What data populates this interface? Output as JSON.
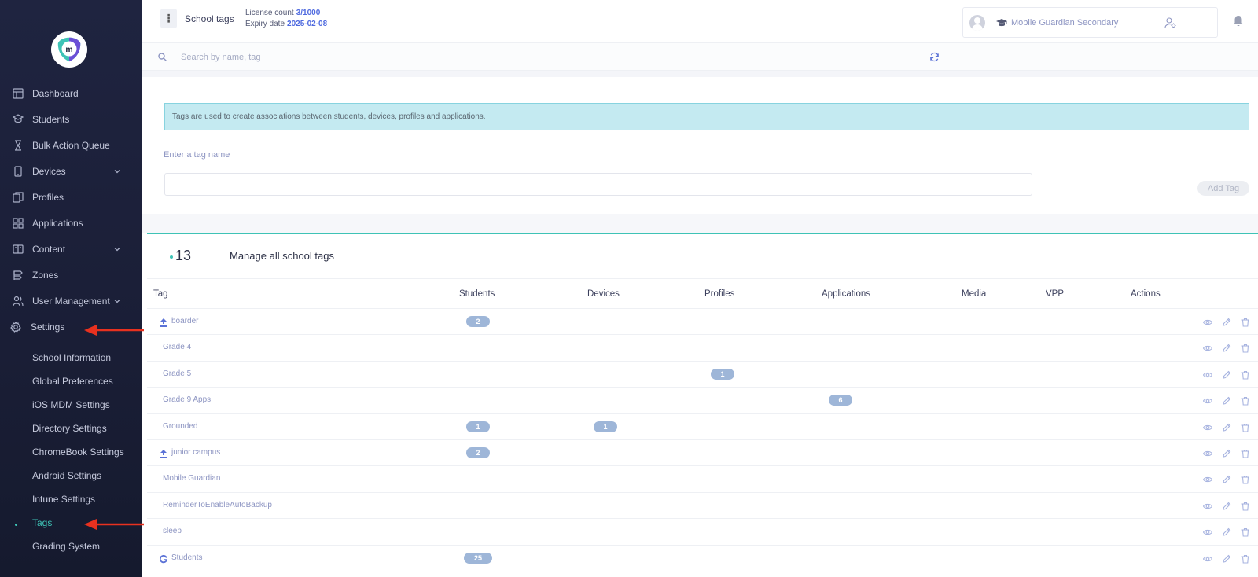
{
  "sidebar": {
    "items": [
      {
        "label": "Dashboard",
        "icon": "dashboard-icon"
      },
      {
        "label": "Students",
        "icon": "students-icon"
      },
      {
        "label": "Bulk Action Queue",
        "icon": "hourglass-icon"
      },
      {
        "label": "Devices",
        "icon": "device-icon",
        "expandable": true
      },
      {
        "label": "Profiles",
        "icon": "profiles-icon"
      },
      {
        "label": "Applications",
        "icon": "applications-icon"
      },
      {
        "label": "Content",
        "icon": "content-icon",
        "expandable": true
      },
      {
        "label": "Zones",
        "icon": "zones-icon"
      },
      {
        "label": "User Management",
        "icon": "user-management-icon",
        "expandable": true
      },
      {
        "label": "Settings",
        "icon": "gear-icon",
        "expanded": true
      }
    ],
    "settings_subitems": [
      {
        "label": "School Information"
      },
      {
        "label": "Global Preferences"
      },
      {
        "label": "iOS MDM Settings"
      },
      {
        "label": "Directory Settings"
      },
      {
        "label": "ChromeBook Settings"
      },
      {
        "label": "Android Settings"
      },
      {
        "label": "Intune Settings"
      },
      {
        "label": "Tags",
        "active": true
      },
      {
        "label": "Grading System"
      }
    ]
  },
  "header": {
    "title": "School tags",
    "license_label": "License count",
    "license_value": "3/1000",
    "expiry_label": "Expiry date",
    "expiry_value": "2025-02-08",
    "school_name": "Mobile Guardian Secondary"
  },
  "search": {
    "placeholder": "Search by name, tag"
  },
  "info": {
    "message": "Tags are used to create associations between students, devices, profiles and applications."
  },
  "form": {
    "label": "Enter a tag name",
    "input_value": "",
    "add_button": "Add Tag"
  },
  "tags_table": {
    "count": "13",
    "title": "Manage all school tags",
    "columns": [
      "Tag",
      "Students",
      "Devices",
      "Profiles",
      "Applications",
      "Media",
      "VPP",
      "Actions"
    ],
    "rows": [
      {
        "tag": "boarder",
        "source": "upload",
        "students": "2",
        "devices": "",
        "profiles": "",
        "applications": ""
      },
      {
        "tag": "Grade 4",
        "source": "",
        "students": "",
        "devices": "",
        "profiles": "",
        "applications": ""
      },
      {
        "tag": "Grade 5",
        "source": "",
        "students": "",
        "devices": "",
        "profiles": "1",
        "applications": ""
      },
      {
        "tag": "Grade 9 Apps",
        "source": "",
        "students": "",
        "devices": "",
        "profiles": "",
        "applications": "6"
      },
      {
        "tag": "Grounded",
        "source": "",
        "students": "1",
        "devices": "1",
        "profiles": "",
        "applications": ""
      },
      {
        "tag": "junior campus",
        "source": "upload",
        "students": "2",
        "devices": "",
        "profiles": "",
        "applications": ""
      },
      {
        "tag": "Mobile Guardian",
        "source": "",
        "students": "",
        "devices": "",
        "profiles": "",
        "applications": ""
      },
      {
        "tag": "ReminderToEnableAutoBackup",
        "source": "",
        "students": "",
        "devices": "",
        "profiles": "",
        "applications": ""
      },
      {
        "tag": "sleep",
        "source": "",
        "students": "",
        "devices": "",
        "profiles": "",
        "applications": ""
      },
      {
        "tag": "Students",
        "source": "google",
        "students": "25",
        "devices": "",
        "profiles": "",
        "applications": ""
      }
    ]
  },
  "colors": {
    "sidebar_bg": "#1c2139",
    "accent_teal": "#3ec3b6",
    "link_blue": "#4f6adf",
    "badge": "#9eb6d8",
    "info_bg": "#c4eaf1",
    "annotation_arrow": "#e8311f"
  }
}
